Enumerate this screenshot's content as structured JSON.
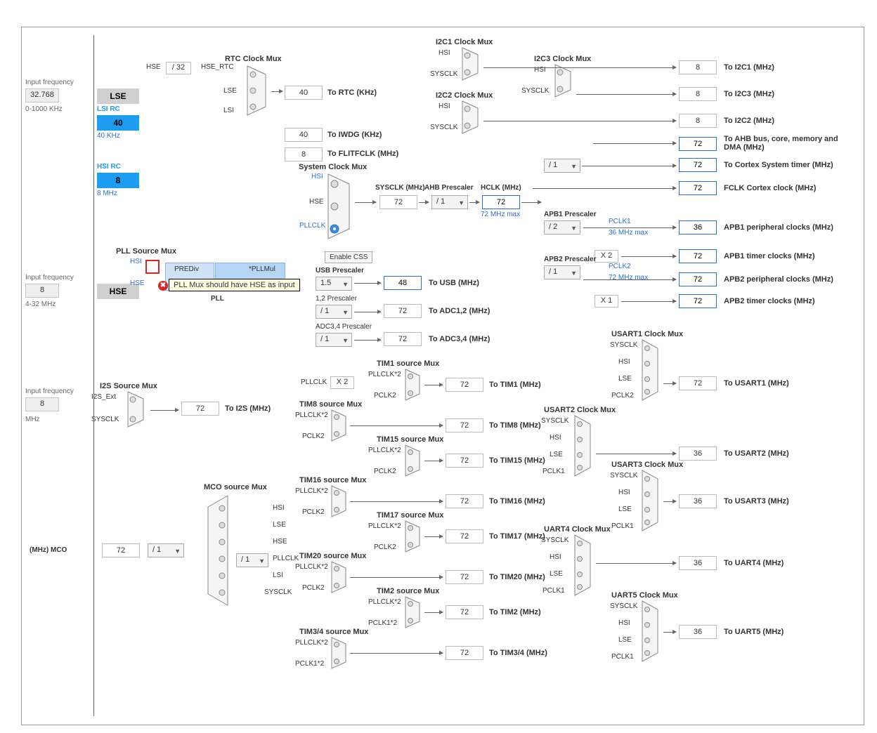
{
  "inputs": {
    "lse": {
      "label": "Input frequency",
      "value": "32.768",
      "range": "0-1000 KHz"
    },
    "hse": {
      "label": "Input frequency",
      "value": "8",
      "range": "4-32 MHz"
    },
    "i2s": {
      "label": "Input frequency",
      "value": "8",
      "unit": "MHz"
    }
  },
  "osc": {
    "lse": "LSE",
    "lsi_rc_title": "LSI RC",
    "lsi_rc": "40",
    "lsi_note": "40 KHz",
    "hsi_rc_title": "HSI RC",
    "hsi_rc": "8",
    "hsi_note": "8 MHz",
    "hse": "HSE"
  },
  "rtc": {
    "mux_title": "RTC Clock Mux",
    "hse": "HSE",
    "div32": "/ 32",
    "hse_rtc": "HSE_RTC",
    "lse": "LSE",
    "lsi": "LSI",
    "rtc_val": "40",
    "rtc_label": "To RTC (KHz)",
    "iwdg_val": "40",
    "iwdg_label": "To IWDG (KHz)",
    "flitf_val": "8",
    "flitf_label": "To FLITFCLK (MHz)"
  },
  "pll": {
    "src_title": "PLL Source Mux",
    "hsi": "HSI",
    "hse": "HSE",
    "prediv": "PREDiv",
    "pllmul": "*PLLMul",
    "name": "PLL",
    "tooltip": "PLL Mux should have HSE as input"
  },
  "sysclk": {
    "title": "System Clock Mux",
    "hsi": "HSI",
    "hse": "HSE",
    "pllclk": "PLLCLK",
    "out_label": "SYSCLK (MHz)",
    "out_val": "72",
    "css_btn": "Enable CSS"
  },
  "usb": {
    "title": "USB Prescaler",
    "sel": "1.5",
    "val": "48",
    "label": "To USB (MHz)"
  },
  "adc12": {
    "title": "1,2 Prescaler",
    "sel": "/ 1",
    "val": "72",
    "label": "To ADC1,2 (MHz)"
  },
  "adc34": {
    "title": "ADC3,4 Prescaler",
    "sel": "/ 1",
    "val": "72",
    "label": "To ADC3,4 (MHz)"
  },
  "ahb": {
    "title": "AHB Prescaler",
    "sel": "/ 1",
    "hclk_title": "HCLK (MHz)",
    "hclk": "72",
    "hclk_note": "72 MHz max"
  },
  "bus": {
    "cortex_div": "/ 1",
    "apb1_title": "APB1 Prescaler",
    "apb1_sel": "/ 2",
    "apb1_x": "X 2",
    "apb2_title": "APB2 Prescaler",
    "apb2_sel": "/ 1",
    "apb2_x": "X 1",
    "pclk1": "PCLK1",
    "pclk1_note": "36 MHz max",
    "pclk2": "PCLK2",
    "pclk2_note": "72 MHz max"
  },
  "outputs": {
    "ahb": "72",
    "ahb_label": "To AHB bus, core, memory and DMA (MHz)",
    "cortex": "72",
    "cortex_label": "To Cortex System timer (MHz)",
    "fclk": "72",
    "fclk_label": "FCLK Cortex clock (MHz)",
    "apb1p": "36",
    "apb1p_label": "APB1 peripheral clocks (MHz)",
    "apb1t": "72",
    "apb1t_label": "APB1 timer clocks (MHz)",
    "apb2p": "72",
    "apb2p_label": "APB2 peripheral clocks (MHz)",
    "apb2t": "72",
    "apb2t_label": "APB2 timer clocks (MHz)"
  },
  "i2c": {
    "i2c1_title": "I2C1 Clock Mux",
    "i2c2_title": "I2C2 Clock Mux",
    "i2c3_title": "I2C3 Clock Mux",
    "hsi": "HSI",
    "sysclk": "SYSCLK",
    "i2c1": "8",
    "i2c1_label": "To I2C1 (MHz)",
    "i2c3": "8",
    "i2c3_label": "To I2C3 (MHz)",
    "i2c2": "8",
    "i2c2_label": "To I2C2 (MHz)"
  },
  "i2s": {
    "title": "I2S Source Mux",
    "ext": "I2S_Ext",
    "sysclk": "SYSCLK",
    "val": "72",
    "label": "To I2S (MHz)"
  },
  "mco": {
    "title": "MCO source Mux",
    "sel": "/ 1",
    "pllsel": "/ 1",
    "val": "72",
    "label": "(MHz) MCO",
    "srcs": [
      "HSI",
      "LSE",
      "HSE",
      "PLLCLK",
      "LSI",
      "SYSCLK"
    ]
  },
  "tim": {
    "pll_x2": "X 2",
    "pllclk": "PLLCLK",
    "pllclk2": "PLLCLK*2",
    "pclk2": "PCLK2",
    "pclk1_2": "PCLK1*2",
    "t1": {
      "title": "TIM1 source Mux",
      "val": "72",
      "label": "To TIM1 (MHz)"
    },
    "t8": {
      "title": "TIM8 source Mux",
      "val": "72",
      "label": "To TIM8 (MHz)"
    },
    "t15": {
      "title": "TIM15 source Mux",
      "val": "72",
      "label": "To TIM15 (MHz)"
    },
    "t16": {
      "title": "TIM16 source Mux",
      "val": "72",
      "label": "To TIM16 (MHz)"
    },
    "t17": {
      "title": "TIM17 source Mux",
      "val": "72",
      "label": "To TIM17 (MHz)"
    },
    "t20": {
      "title": "TIM20 source Mux",
      "val": "72",
      "label": "To TIM20 (MHz)"
    },
    "t2": {
      "title": "TIM2 source Mux",
      "val": "72",
      "label": "To TIM2 (MHz)"
    },
    "t34": {
      "title": "TIM3/4 source Mux",
      "val": "72",
      "label": "To TIM3/4 (MHz)"
    }
  },
  "usart": {
    "sigs": [
      "SYSCLK",
      "HSI",
      "LSE",
      "PCLK2"
    ],
    "sigs1": [
      "SYSCLK",
      "HSI",
      "LSE",
      "PCLK1"
    ],
    "u1": {
      "title": "USART1 Clock Mux",
      "val": "72",
      "label": "To USART1 (MHz)"
    },
    "u2": {
      "title": "USART2 Clock Mux",
      "val": "36",
      "label": "To USART2 (MHz)"
    },
    "u3": {
      "title": "USART3 Clock Mux",
      "val": "36",
      "label": "To USART3 (MHz)"
    },
    "u4": {
      "title": "UART4 Clock Mux",
      "val": "36",
      "label": "To UART4 (MHz)"
    },
    "u5": {
      "title": "UART5 Clock Mux",
      "val": "36",
      "label": "To UART5 (MHz)"
    }
  }
}
